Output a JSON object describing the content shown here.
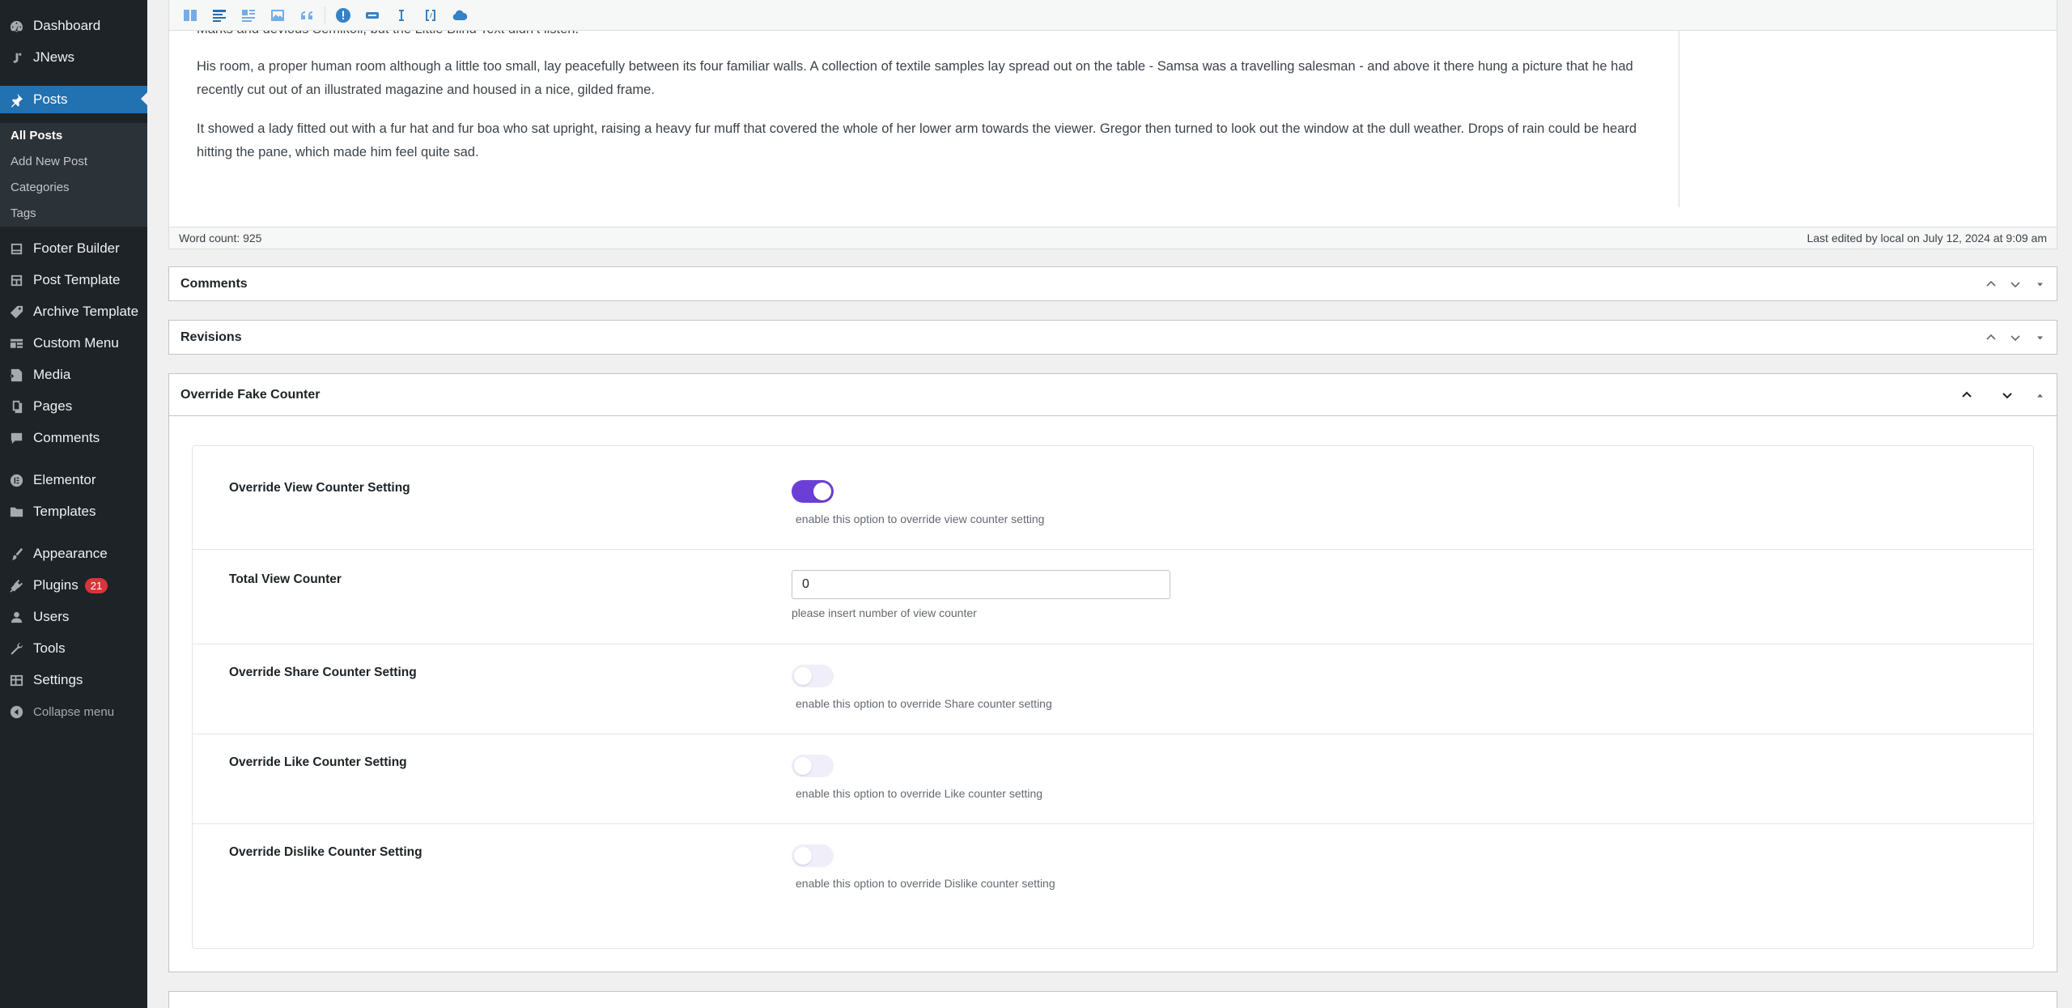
{
  "sidebar": {
    "menu": [
      {
        "label": "Dashboard",
        "icon": "dashboard-icon"
      },
      {
        "label": "JNews",
        "icon": "jnews-icon"
      },
      {
        "label": "Posts",
        "icon": "pushpin-icon"
      },
      {
        "label": "Footer Builder",
        "icon": "footer-icon"
      },
      {
        "label": "Post Template",
        "icon": "post-template-icon"
      },
      {
        "label": "Archive Template",
        "icon": "archive-template-icon"
      },
      {
        "label": "Custom Menu",
        "icon": "custom-menu-icon"
      },
      {
        "label": "Media",
        "icon": "media-icon"
      },
      {
        "label": "Pages",
        "icon": "pages-icon"
      },
      {
        "label": "Comments",
        "icon": "comments-icon"
      },
      {
        "label": "Elementor",
        "icon": "elementor-icon"
      },
      {
        "label": "Templates",
        "icon": "folder-icon"
      },
      {
        "label": "Appearance",
        "icon": "paintbrush-icon"
      },
      {
        "label": "Plugins",
        "icon": "plug-icon",
        "badge": "21"
      },
      {
        "label": "Users",
        "icon": "users-icon"
      },
      {
        "label": "Tools",
        "icon": "wrench-icon"
      },
      {
        "label": "Settings",
        "icon": "settings-icon"
      },
      {
        "label": "Collapse menu",
        "icon": "collapse-icon"
      }
    ],
    "submenu": [
      "All Posts",
      "Add New Post",
      "Categories",
      "Tags"
    ]
  },
  "editor": {
    "paragraphs": [
      "Marks and devious Semikoli, but the Little Blind Text didn’t listen.",
      "His room, a proper human room although a little too small, lay peacefully between its four familiar walls. A collection of textile samples lay spread out on the table - Samsa was a travelling salesman - and above it there hung a picture that he had recently cut out of an illustrated magazine and housed in a nice, gilded frame.",
      "It showed a lady fitted out with a fur hat and fur boa who sat upright, raising a heavy fur muff that covered the whole of her lower arm towards the viewer. Gregor then turned to look out the window at the dull weather. Drops of rain could be heard hitting the pane, which made him feel quite sad."
    ],
    "word_count": "Word count: 925",
    "last_edited": "Last edited by local on July 12, 2024 at 9:09 am"
  },
  "metaboxes": {
    "comments": "Comments",
    "revisions": "Revisions",
    "fake_counter": "Override Fake Counter"
  },
  "fake_counter": {
    "rows": [
      {
        "label": "Override View Counter Setting",
        "desc": "enable this option to override view counter setting",
        "enabled": true
      },
      {
        "label": "Total View Counter",
        "desc": "please insert number of view counter",
        "value": "0"
      },
      {
        "label": "Override Share Counter Setting",
        "desc": "enable this option to override Share counter setting",
        "enabled": false
      },
      {
        "label": "Override Like Counter Setting",
        "desc": "enable this option to override Like counter setting",
        "enabled": false
      },
      {
        "label": "Override Dislike Counter Setting",
        "desc": "enable this option to override Dislike counter setting",
        "enabled": false
      }
    ]
  },
  "colors": {
    "sidebar_bg": "#1d2327",
    "active_menu": "#2271b1",
    "toggle_on": "#6b3fd6",
    "plugin_badge": "#d63638"
  }
}
